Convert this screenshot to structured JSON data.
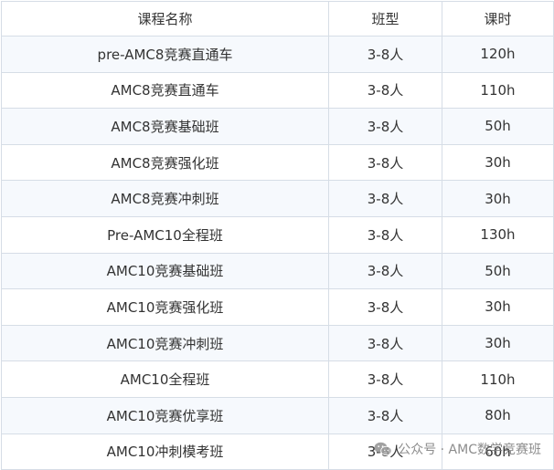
{
  "table": {
    "headers": [
      "课程名称",
      "班型",
      "课时"
    ],
    "rows": [
      [
        "pre-AMC8竞赛直通车",
        "3-8人",
        "120h"
      ],
      [
        "AMC8竞赛直通车",
        "3-8人",
        "110h"
      ],
      [
        "AMC8竞赛基础班",
        "3-8人",
        "50h"
      ],
      [
        "AMC8竞赛强化班",
        "3-8人",
        "30h"
      ],
      [
        "AMC8竞赛冲刺班",
        "3-8人",
        "30h"
      ],
      [
        "Pre-AMC10全程班",
        "3-8人",
        "130h"
      ],
      [
        "AMC10竞赛基础班",
        "3-8人",
        "50h"
      ],
      [
        "AMC10竞赛强化班",
        "3-8人",
        "30h"
      ],
      [
        "AMC10竞赛冲刺班",
        "3-8人",
        "30h"
      ],
      [
        "AMC10全程班",
        "3-8人",
        "110h"
      ],
      [
        "AMC10竞赛优享班",
        "3-8人",
        "80h"
      ],
      [
        "AMC10冲刺模考班",
        "3-8人",
        "60h"
      ]
    ]
  },
  "watermark": {
    "icon": "wechat-icon",
    "text": "公众号 · AMC数学竞赛班"
  }
}
